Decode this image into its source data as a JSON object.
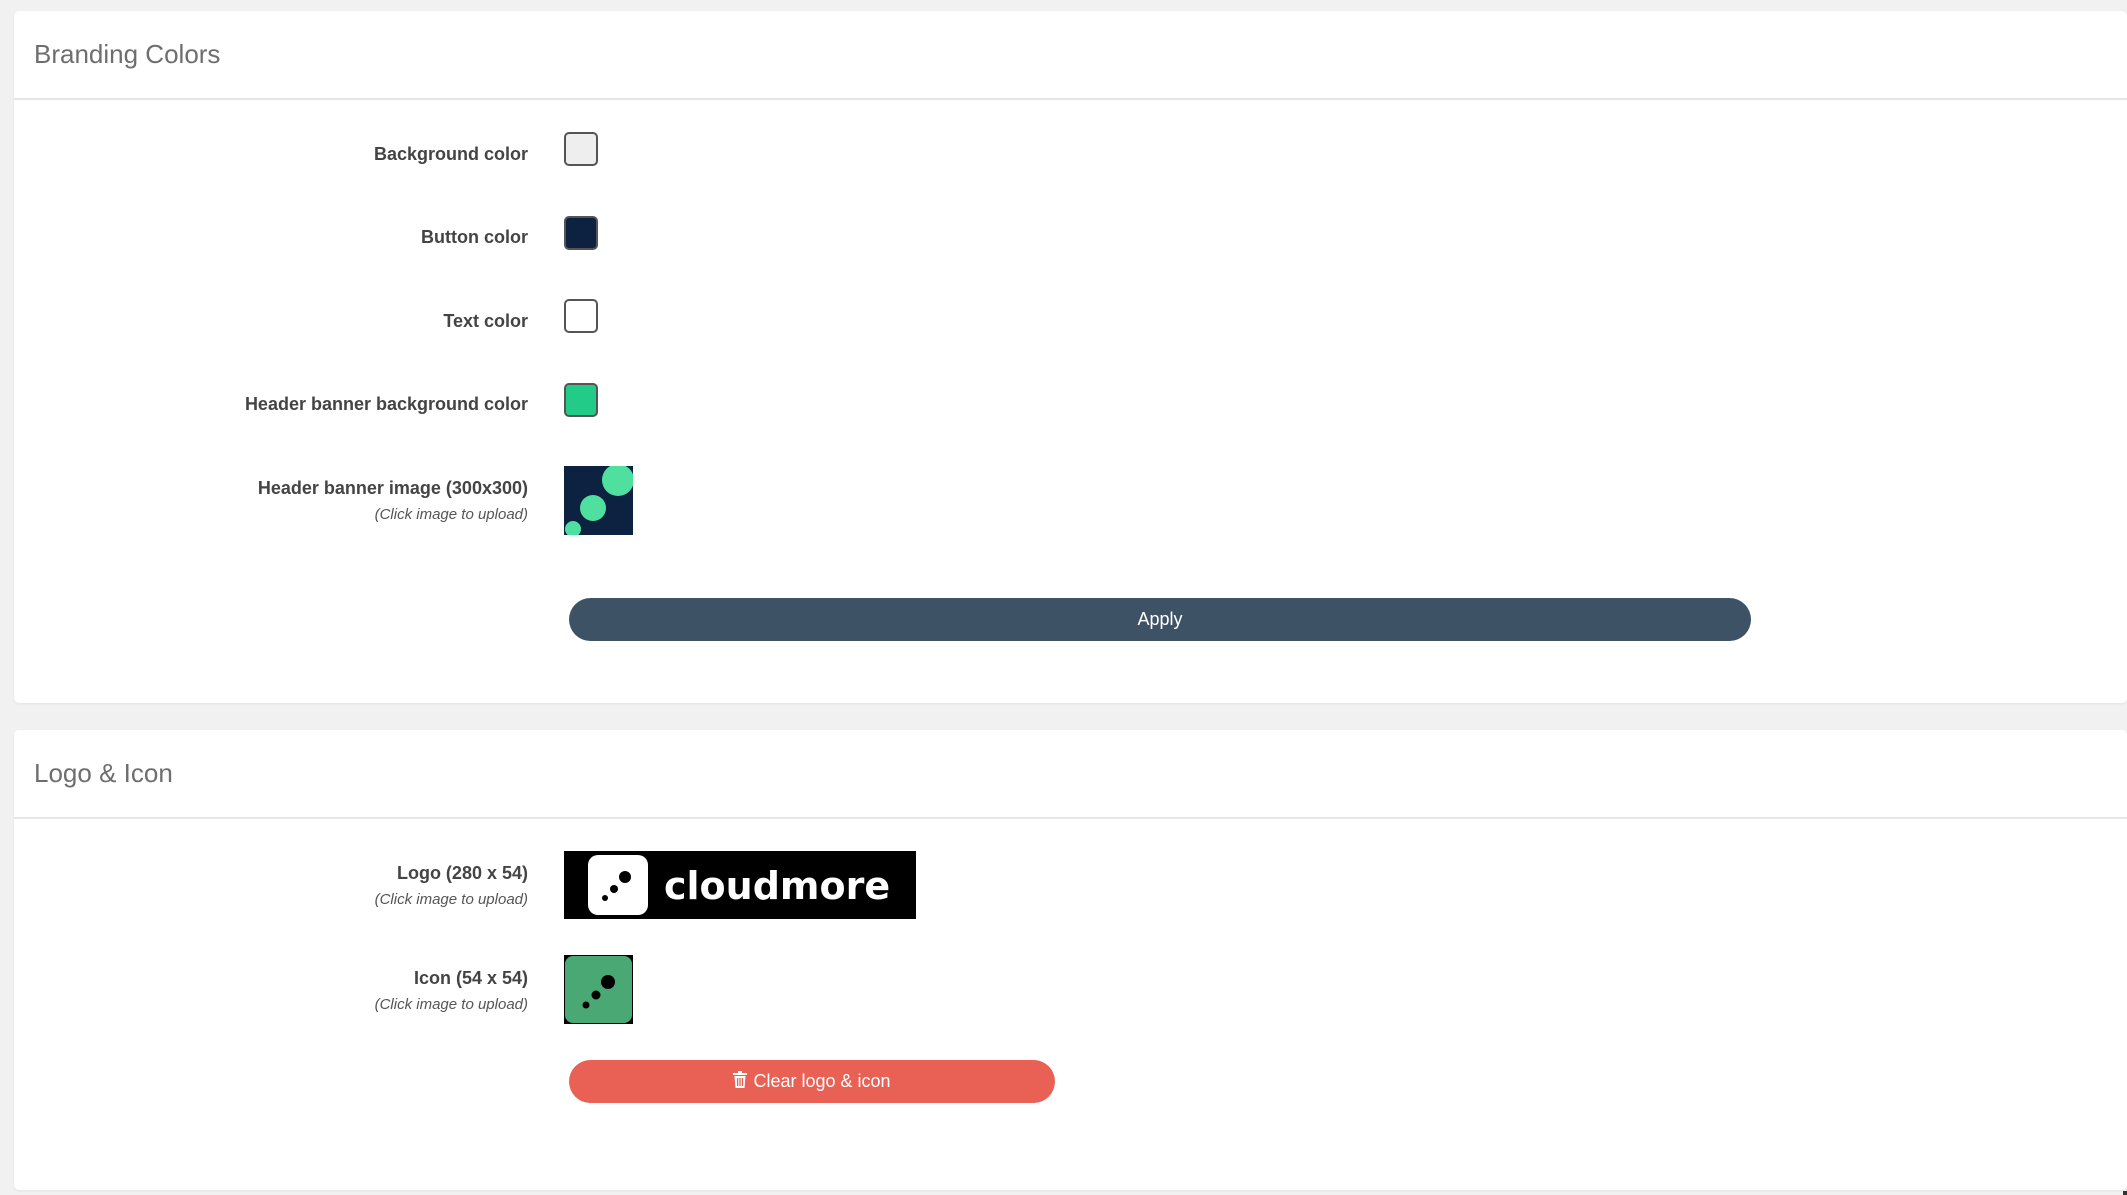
{
  "branding": {
    "title": "Branding Colors",
    "fields": [
      {
        "label": "Background color",
        "color": "#eeeeee"
      },
      {
        "label": "Button color",
        "color": "#0d2240"
      },
      {
        "label": "Text color",
        "color": "#ffffff"
      },
      {
        "label": "Header banner background color",
        "color": "#22cc88"
      }
    ],
    "banner_image": {
      "label": "Header banner image (300x300)",
      "hint": "(Click image to upload)"
    },
    "apply_label": "Apply"
  },
  "logo_section": {
    "title": "Logo & Icon",
    "logo": {
      "label": "Logo (280 x 54)",
      "hint": "(Click image to upload)",
      "text": "cloudmore"
    },
    "icon": {
      "label": "Icon (54 x 54)",
      "hint": "(Click image to upload)"
    },
    "clear_label": "Clear logo & icon",
    "clear_icon": "trash-icon"
  },
  "colors": {
    "apply_button": "#3e5266",
    "clear_button": "#e86154",
    "banner_bg": "#0d2240",
    "banner_circles": "#4fe0a0",
    "icon_bg": "#4aa874"
  }
}
